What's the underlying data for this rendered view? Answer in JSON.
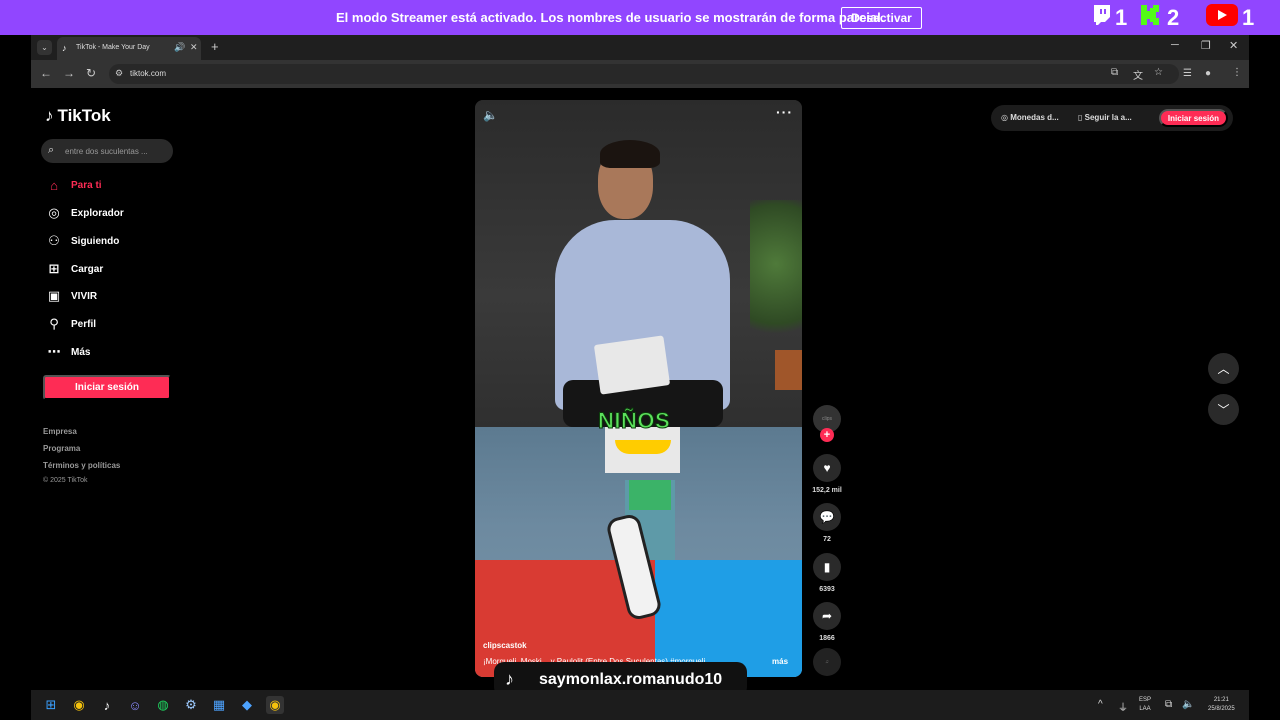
{
  "banner": {
    "text": "El modo Streamer está activado. Los nombres de usuario se mostrarán de forma parcial.",
    "button": "Desactivar",
    "viewers": [
      {
        "platform_icon": "twitch-icon",
        "count": "1"
      },
      {
        "platform_icon": "kick-icon",
        "count": "2"
      },
      {
        "platform_icon": "youtube-icon",
        "count": "1"
      }
    ]
  },
  "browser": {
    "tab_title": "TikTok - Make Your Day",
    "url": "tiktok.com"
  },
  "sidebar": {
    "logo": "TikTok",
    "search_placeholder": "entre dos suculentas ...",
    "items": [
      {
        "label": "Para ti",
        "icon": "home-icon"
      },
      {
        "label": "Explorador",
        "icon": "compass-icon"
      },
      {
        "label": "Siguiendo",
        "icon": "following-icon"
      },
      {
        "label": "Cargar",
        "icon": "upload-icon"
      },
      {
        "label": "VIVIR",
        "icon": "live-icon"
      },
      {
        "label": "Perfil",
        "icon": "profile-icon"
      },
      {
        "label": "Más",
        "icon": "more-icon"
      }
    ],
    "login": "Iniciar sesión",
    "footer": [
      "Empresa",
      "Programa",
      "Términos y políticas"
    ],
    "copyright": "© 2025 TikTok"
  },
  "topright": {
    "coins": "Monedas d...",
    "follow": "Seguir la a...",
    "login": "Iniciar sesión"
  },
  "video": {
    "caption": "NIÑOS",
    "author": "clipscastok",
    "description": "¡Morgueli, Moski... y Paulolit (Entre Dos Suculentas) #morgueli",
    "more": "más"
  },
  "actions": {
    "likes": "152,2 mil",
    "comments": "72",
    "saves": "6393",
    "shares": "1866"
  },
  "overlay": {
    "username": "saymonlax.romanudo10"
  },
  "taskbar": {
    "lang_top": "ESP",
    "lang_bottom": "LAA",
    "time": "21:21",
    "date": "25/8/2025"
  },
  "colors": {
    "banner": "#9146ff",
    "accent": "#fe2c55"
  }
}
